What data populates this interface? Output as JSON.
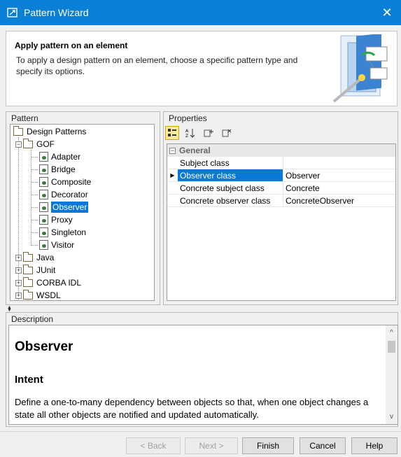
{
  "window": {
    "title": "Pattern Wizard",
    "close_glyph": "✕"
  },
  "header": {
    "title": "Apply pattern on an element",
    "description": "To apply a design pattern on an element, choose a specific pattern type and specify its options."
  },
  "pattern_panel": {
    "label": "Pattern",
    "root": "Design Patterns",
    "gof": "GOF",
    "gof_children": [
      "Adapter",
      "Bridge",
      "Composite",
      "Decorator",
      "Observer",
      "Proxy",
      "Singleton",
      "Visitor"
    ],
    "selected": "Observer",
    "other_folders": [
      "Java",
      "JUnit",
      "CORBA IDL",
      "WSDL"
    ]
  },
  "properties_panel": {
    "label": "Properties",
    "category": "General",
    "rows": [
      {
        "name": "Subject class",
        "value": ""
      },
      {
        "name": "Observer class",
        "value": "Observer"
      },
      {
        "name": "Concrete subject class",
        "value": "Concrete"
      },
      {
        "name": "Concrete observer class",
        "value": "ConcreteObserver"
      }
    ]
  },
  "description_panel": {
    "label": "Description",
    "heading": "Observer",
    "subheading": "Intent",
    "text": "Define a one-to-many dependency between objects so that, when one object changes a state all other objects are notified and updated automatically."
  },
  "buttons": {
    "back": "< Back",
    "next": "Next >",
    "finish": "Finish",
    "cancel": "Cancel",
    "help": "Help"
  },
  "colors": {
    "titlebar": "#0a7fd6",
    "selection": "#0a78d7"
  }
}
